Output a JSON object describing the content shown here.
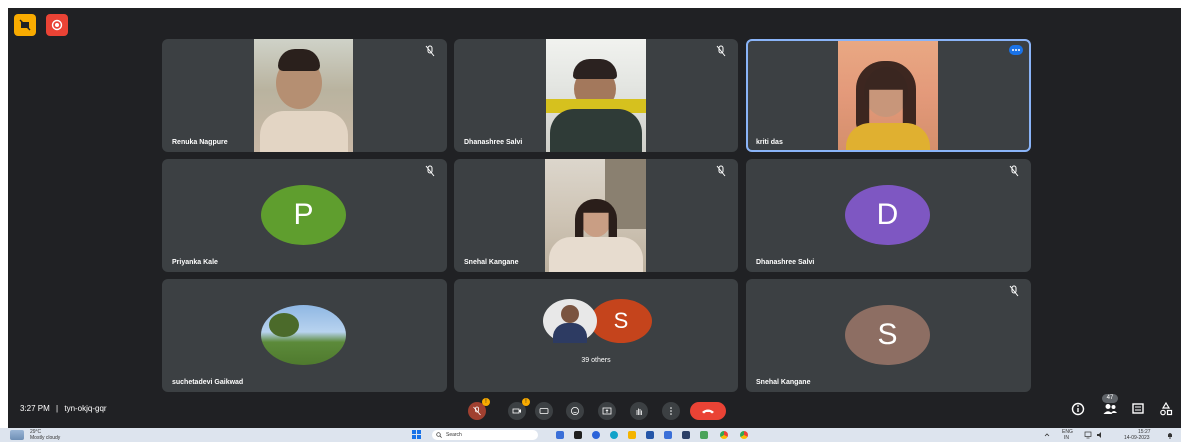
{
  "meeting": {
    "time": "3:27 PM",
    "separator": "|",
    "code": "tyn-okjq-gqr",
    "participant_count": "47"
  },
  "participants": [
    {
      "name": "Renuka Nagpure",
      "type": "video",
      "muted": true
    },
    {
      "name": "Dhanashree Salvi",
      "type": "video",
      "muted": true
    },
    {
      "name": "kriti das",
      "type": "video",
      "muted": false,
      "active_speaker": true
    },
    {
      "name": "Priyanka Kale",
      "type": "avatar",
      "initial": "P",
      "color": "#5f9e2e",
      "muted": true
    },
    {
      "name": "Snehal Kangane",
      "type": "video",
      "muted": true
    },
    {
      "name": "Dhanashree Salvi",
      "type": "avatar",
      "initial": "D",
      "color": "#7e57c2",
      "muted": true
    },
    {
      "name": "suchetadevi Gaikwad",
      "type": "photo-avatar",
      "muted": false
    },
    {
      "name": "39 others",
      "type": "others",
      "initial": "S",
      "color": "#c5441c"
    },
    {
      "name": "Snehal Kangane",
      "type": "avatar",
      "initial": "S",
      "color": "#8d6e63",
      "muted": true
    }
  ],
  "controls": {
    "mic_badge": "!",
    "camera_badge": "!",
    "icons": [
      "mic-off-icon",
      "camera-off-icon",
      "captions-icon",
      "emoji-icon",
      "present-icon",
      "raise-hand-icon",
      "more-options-icon",
      "end-call-icon"
    ]
  },
  "top_badges": [
    "recording-badge-icon",
    "record-icon"
  ],
  "right_icons": [
    "info-icon",
    "people-icon",
    "chat-icon",
    "activities-icon"
  ],
  "taskbar": {
    "temperature": "29°C",
    "weather": "Mostly cloudy",
    "search_placeholder": "Search",
    "language": "ENG",
    "region": "IN",
    "clock_time": "15:27",
    "clock_date": "14-09-2023"
  },
  "colors": {
    "background": "#202124",
    "tile": "#3c4043",
    "end_call": "#ea4335",
    "active_border": "#8ab4f8"
  }
}
